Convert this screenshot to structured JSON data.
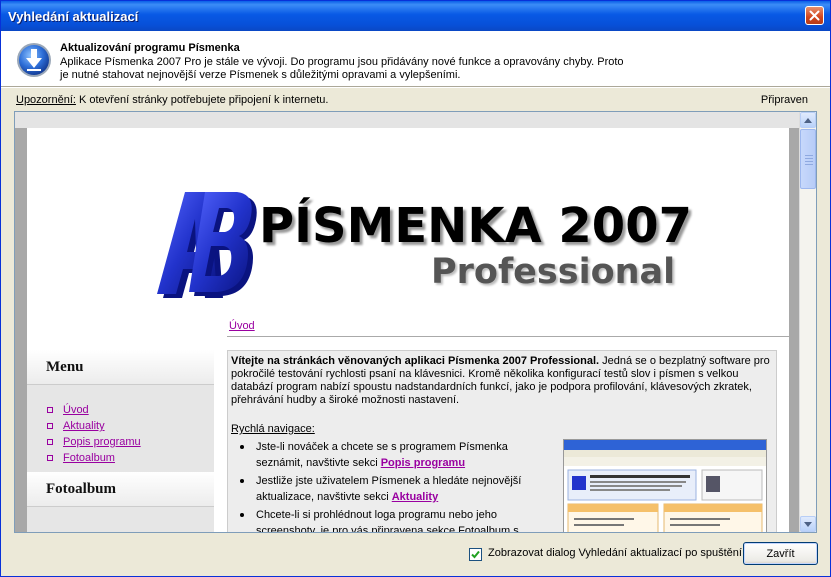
{
  "window": {
    "title": "Vyhledání aktualizací"
  },
  "header": {
    "title": "Aktualizování programu Písmenka",
    "description": "Aplikace Písmenka 2007 Pro je stále ve vývoji. Do programu jsou přidávány nové funkce a opravovány chyby. Proto je nutné stahovat nejnovější verze Písmenek s důležitými opravami a vylepšeními."
  },
  "notice": {
    "label": "Upozornění:",
    "text": " K otevření stránky potřebujete připojení k internetu."
  },
  "status": "Připraven",
  "page": {
    "logo_title": "PÍSMENKA 2007",
    "logo_subtitle": "Professional",
    "breadcrumb": "Úvod",
    "sidebar": {
      "menu_heading": "Menu",
      "menu_items": [
        "Úvod",
        "Aktuality",
        "Popis programu",
        "Fotoalbum"
      ],
      "second_heading": "Fotoalbum"
    },
    "content": {
      "intro_bold": "Vítejte na stránkách věnovaných aplikaci Písmenka 2007 Professional.",
      "intro_rest": " Jedná se o bezplatný software pro pokročilé testování rychlosti psaní na klávesnici. Kromě několika konfigurací testů slov i písmen s velkou databází program nabízí spoustu nadstandardních funkcí, jako je podpora profilování, klávesových zkratek, přehrávání hudby a široké možnosti nastavení.",
      "nav_title": "Rychlá navigace:",
      "nav_items": [
        {
          "text": "Jste-li nováček a chcete se s programem Písmenka seznámit, navštivte sekci ",
          "link": "Popis programu"
        },
        {
          "text": "Jestliže jste uživatelem Písmenek a hledáte nejnovější aktualizace, navštivte sekci ",
          "link": "Aktuality"
        },
        {
          "text": "Chcete-li si prohlédnout loga programu nebo jeho screenshoty, je pro vás připravena sekce Fotoalbum s",
          "link": ""
        }
      ]
    }
  },
  "footer": {
    "checkbox_label": "Zobrazovat dialog Vyhledání aktualizací po spuštění",
    "checkbox_checked": true,
    "close_label": "Zavřít"
  },
  "colors": {
    "titlebar": "#0859E5",
    "link": "#9900A0",
    "logo_blue": "#2233CC"
  }
}
